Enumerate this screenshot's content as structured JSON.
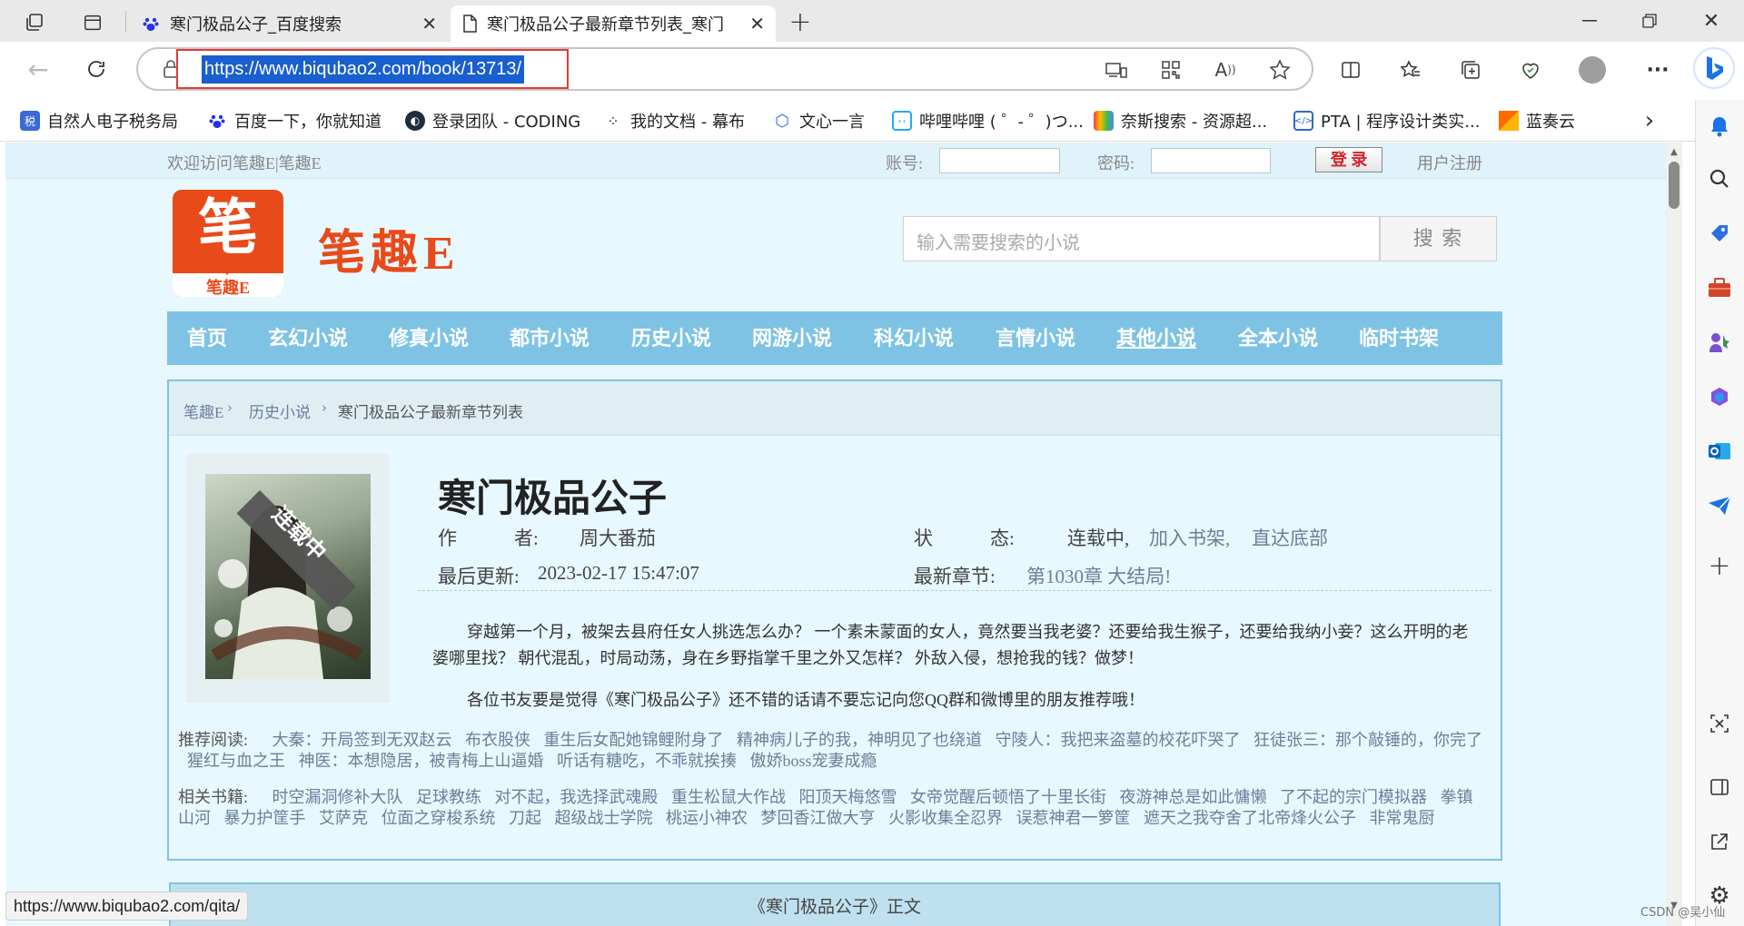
{
  "browser": {
    "tabs": [
      {
        "title": "寒门极品公子_百度搜索"
      },
      {
        "title": "寒门极品公子最新章节列表_寒门"
      }
    ],
    "url": "https://www.biqubao2.com/book/13713/",
    "status_url": "https://www.biqubao2.com/qita/",
    "bookmarks": [
      {
        "label": "自然人电子税务局"
      },
      {
        "label": "百度一下，你就知道"
      },
      {
        "label": "登录团队 - CODING"
      },
      {
        "label": "我的文档 - 幕布"
      },
      {
        "label": "文心一言"
      },
      {
        "label": "哔哩哔哩 ( ゜- ゜)つ..."
      },
      {
        "label": "奈斯搜索 - 资源超..."
      },
      {
        "label": "PTA | 程序设计类实..."
      },
      {
        "label": "蓝奏云"
      }
    ]
  },
  "site": {
    "welcome": "欢迎访问笔趣E|笔趣E",
    "account_label": "账号:",
    "password_label": "密码:",
    "login_button": "登 录",
    "register_link": "用户注册",
    "logo_char": "笔",
    "logo_sub": "笔趣E",
    "logo_title": "笔趣E",
    "search_placeholder": "输入需要搜索的小说",
    "search_button": "搜 索",
    "nav": [
      "首页",
      "玄幻小说",
      "修真小说",
      "都市小说",
      "历史小说",
      "网游小说",
      "科幻小说",
      "言情小说",
      "其他小说",
      "全本小说",
      "临时书架"
    ],
    "breadcrumb": [
      "笔趣E",
      "历史小说",
      "寒门极品公子最新章节列表"
    ]
  },
  "book": {
    "badge": "连载中",
    "title": "寒门极品公子",
    "author_label": "作　　　者:",
    "author": "周大番茄",
    "status_label": "状　　　态:",
    "status": "连载中,",
    "add_shelf": "加入书架,",
    "to_bottom": "直达底部",
    "updated_label": "最后更新:",
    "updated": "2023-02-17 15:47:07",
    "latest_label": "最新章节:",
    "latest": "第1030章 大结局!",
    "intro_1": "穿越第一个月，被架去县府任女人挑选怎么办？ 一个素未蒙面的女人，竟然要当我老婆？还要给我生猴子，还要给我纳小妾？这么开明的老婆哪里找？ 朝代混乱，时局动荡，身在乡野指掌千里之外又怎样？ 外敌入侵，想抢我的钱？做梦！",
    "intro_2": "各位书友要是觉得《寒门极品公子》还不错的话请不要忘记向您QQ群和微博里的朋友推荐哦！"
  },
  "recommend": {
    "label": "推荐阅读:",
    "items": [
      "大秦：开局签到无双赵云",
      "布衣股侠",
      "重生后女配她锦鲤附身了",
      "精神病儿子的我，神明见了也绕道",
      "守陵人：我把来盗墓的校花吓哭了",
      "狂徒张三：那个敲锤的，你完了",
      "猩红与血之王",
      "神医：本想隐居，被青梅上山逼婚",
      "听话有糖吃，不乖就挨揍",
      "傲娇boss宠妻成瘾"
    ]
  },
  "related": {
    "label": "相关书籍:",
    "items": [
      "时空漏洞修补大队",
      "足球教练",
      "对不起，我选择武魂殿",
      "重生松鼠大作战",
      "阳顶天梅悠雪",
      "女帝觉醒后顿悟了十里长街",
      "夜游神总是如此慵懒",
      "了不起的宗门模拟器",
      "拳镇山河",
      "暴力护筐手",
      "艾萨克",
      "位面之穿梭系统",
      "刀起",
      "超级战士学院",
      "桃运小神农",
      "梦回香江做大亨",
      "火影收集全忍界",
      "误惹神君一箩筐",
      "遮天之我夺舍了北帝烽火公子",
      "非常鬼厨"
    ]
  },
  "footer": {
    "section_title": "《寒门极品公子》正文",
    "watermark": "CSDN @吴小仙"
  }
}
